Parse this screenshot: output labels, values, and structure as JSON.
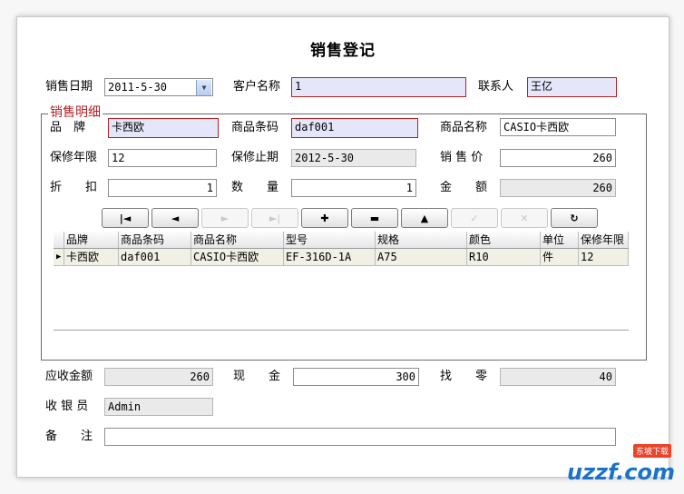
{
  "form": {
    "title": "销售登记",
    "sale_date_label": "销售日期",
    "sale_date_value": "2011-5-30",
    "customer_label": "客户名称",
    "customer_value": "1",
    "contact_label": "联系人",
    "contact_value": "王亿"
  },
  "detail": {
    "group_title": "销售明细",
    "brand_label": "品　牌",
    "brand_value": "卡西欧",
    "barcode_label": "商品条码",
    "barcode_value": "daf001",
    "name_label": "商品名称",
    "name_value": "CASIO卡西欧",
    "warranty_years_label": "保修年限",
    "warranty_years_value": "12",
    "warranty_end_label": "保修止期",
    "warranty_end_value": "2012-5-30",
    "price_label": "销 售 价",
    "price_value": "260",
    "discount_label": "折　　扣",
    "discount_value": "1",
    "quantity_label": "数　　量",
    "quantity_value": "1",
    "amount_label": "金　　额",
    "amount_value": "260"
  },
  "navigator": {
    "first": "|◄",
    "prev": "◄",
    "next": "►",
    "last": "►|",
    "insert": "✚",
    "delete": "▬",
    "edit": "▲",
    "post": "✓",
    "cancel": "✕",
    "refresh": "↻"
  },
  "grid": {
    "columns": [
      "品牌",
      "商品条码",
      "商品名称",
      "型号",
      "规格",
      "颜色",
      "单位",
      "保修年限"
    ],
    "rows": [
      [
        "卡西欧",
        "daf001",
        "CASIO卡西欧",
        "EF-316D-1A",
        "A75",
        "R10",
        "件",
        "12"
      ]
    ]
  },
  "summary": {
    "receivable_label": "应收金额",
    "receivable_value": "260",
    "cash_label": "现　　金",
    "cash_value": "300",
    "change_label": "找　　零",
    "change_value": "40",
    "cashier_label": "收 银 员",
    "cashier_value": "Admin",
    "remark_label": "备　　注",
    "remark_value": ""
  },
  "watermark": {
    "text": "uzzf.com",
    "badge": "东坡下载"
  }
}
